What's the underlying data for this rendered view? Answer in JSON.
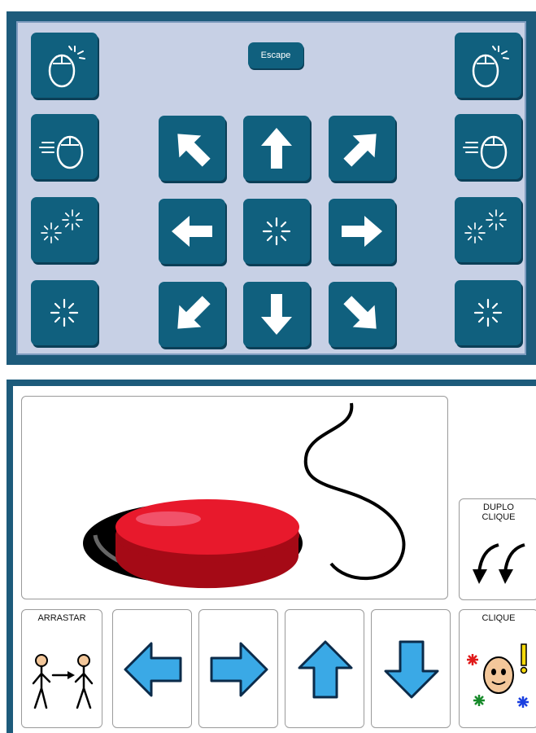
{
  "keyboard_panel": {
    "escape_label": "Escape",
    "background_color": "#c7d0e5",
    "key_color": "#10607e",
    "frame_color": "#1d5b7b",
    "left_column_icons": [
      "mouse-click-icon",
      "mouse-drag-icon",
      "double-click-icon",
      "click-sparkle-icon"
    ],
    "arrow_grid_icons": [
      "arrow-up-left-icon",
      "arrow-up-icon",
      "arrow-up-right-icon",
      "arrow-left-icon",
      "center-sparkle-icon",
      "arrow-right-icon",
      "arrow-down-left-icon",
      "arrow-down-icon",
      "arrow-down-right-icon"
    ],
    "right_column_icons": [
      "mouse-click-icon",
      "mouse-drag-icon",
      "double-click-icon",
      "click-sparkle-icon"
    ]
  },
  "switch_panel": {
    "main_image": "red-switch-button-icon",
    "double_click_label": "DUPLO\nCLIQUE",
    "drag_label": "ARRASTAR",
    "click_label": "CLIQUE",
    "arrow_buttons": [
      "arrow-left-icon",
      "arrow-right-icon",
      "arrow-up-icon",
      "arrow-down-icon"
    ],
    "arrow_color": "#3aa9e6",
    "switch_color": "#e8192c"
  }
}
